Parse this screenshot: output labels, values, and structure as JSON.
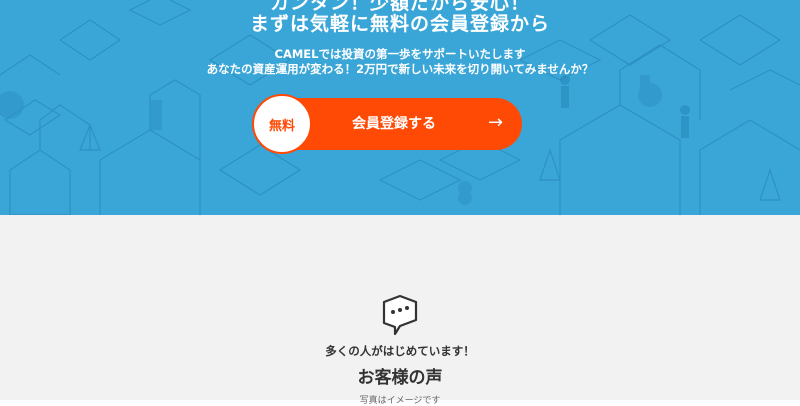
{
  "hero": {
    "title_line1": "カンタン！少額だから安心！",
    "title_line2": "まずは気軽に無料の会員登録から",
    "subtitle_line1": "CAMELでは投資の第一歩をサポートいたします",
    "subtitle_line2": "あなたの資産運用が変わる！2万円で新しい未来を切り開いてみませんか？",
    "background_color": "#3aa6d8"
  },
  "cta": {
    "badge": "無料",
    "label": "会員登録する",
    "arrow": "→",
    "color": "#ff4a05"
  },
  "testimonials": {
    "icon": "chat-bubble-icon",
    "lead": "多くの人がはじめています！",
    "heading": "お客様の声",
    "note": "写真はイメージです"
  }
}
